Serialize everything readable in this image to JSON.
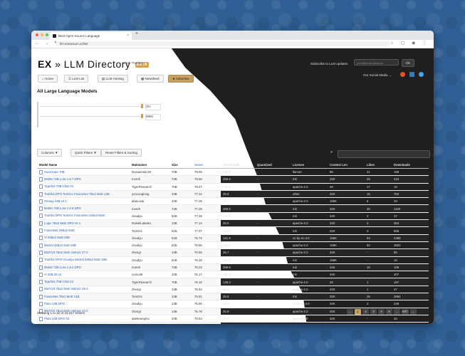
{
  "browser": {
    "tab_title": "Best Open-Source Language",
    "new_tab": "+",
    "url": "llm.extractum.io/list/",
    "nav": "← → ↻"
  },
  "header": {
    "logo_ex": "EX",
    "logo_arrow": "»",
    "logo_title": "LLM Directory",
    "logo_badge": "BETA",
    "tagline": "Dark Theme ◐",
    "subscribe_text": "Subscribe to LLM updates",
    "email_placeholder": "your@email.address",
    "ok_label": "Ok",
    "social_text": "Our Social Media →"
  },
  "nav_buttons": [
    "Home",
    "LLM List",
    "LLM Hosting",
    "Newsfeed",
    "Advertise"
  ],
  "list": {
    "title": "All Large Language Models",
    "range_min": "3%",
    "range_max": "986K",
    "columns_btn": "Columns ▼",
    "quick_filters_btn": "Quick Filters ▼",
    "reset_btn": "Reset Filters & Sorting"
  },
  "table": {
    "headers": [
      "Model Name",
      "Maintainer",
      "Size",
      "Score",
      "VRAM (GB)",
      "Quantized",
      "License",
      "Context Len",
      "Likes",
      "Downloads"
    ],
    "rows": [
      [
        "XuanYuan 70B",
        "Duxiaoman-DI",
        "70B",
        "79.05",
        "138.3",
        "-",
        "llama2",
        "8K",
        "41",
        "158"
      ],
      [
        "MoMo 72B Lora 1.8.7 DPO",
        "moreh",
        "72B",
        "78.56",
        "289.5",
        "-",
        "mit",
        "32K",
        "25",
        "416"
      ],
      [
        "Tigerbot 70B Chat V2",
        "TigerResearch",
        "70B",
        "78.07",
        "138.3",
        "-",
        "apache-2.0",
        "4K",
        "17",
        "10"
      ],
      [
        "Truthful DPO TomGrc FusionNet 7Bx2 MoE 13B",
        "yunconglong",
        "13B",
        "77.44",
        "25.9",
        "-",
        "other",
        "32K",
        "15",
        "763"
      ],
      [
        "Smaug 34B v0.1",
        "abacusai",
        "34B",
        "77.29",
        "69.2",
        "-",
        "apache-2.0",
        "195K",
        "5",
        "33"
      ],
      [
        "MoMo 72B Lora 1.8.6 DPO",
        "moreh",
        "72B",
        "77.29",
        "289.5",
        "-",
        "mit",
        "32K",
        "30",
        "1100"
      ],
      [
        "Truthful DPO TomGrc FusionNet 34Bx2 MoE",
        "cloudyu",
        "61B",
        "77.28",
        "121.9",
        "-",
        "mit",
        "32K",
        "3",
        "37"
      ],
      [
        "Logic 7Bx2 MoE DPO v0.1",
        "RubielLabarta",
        "13B",
        "77.14",
        "25.9",
        "-",
        "apache-2.0",
        "32K",
        "2",
        "363"
      ],
      [
        "FusionNet 34Bx2 MoE",
        "TomGrc",
        "61B",
        "77.07",
        "121.2",
        "-",
        "mit",
        "32K",
        "3",
        "556"
      ],
      [
        "Yi 34Bx2 MoE 60B",
        "cloudyu",
        "61B",
        "76.72",
        "121.9",
        "-",
        "cc-by-nc-4.0",
        "195K",
        "53",
        "2488"
      ],
      [
        "Mixtral 34Bx2 MoE 60B",
        "cloudyu",
        "61B",
        "76.66",
        "121.9",
        "-",
        "apache-2.0",
        "195K",
        "92",
        "3602"
      ],
      [
        "MixTAO 7Bx2 MoE Instruct V7.0",
        "zhengr",
        "13B",
        "76.55",
        "25.7",
        "-",
        "apache-2.0",
        "32K",
        "-",
        "85"
      ],
      [
        "Truthful DPO Cloudyu Mixtral 34Bx2 MoE 60B",
        "cloudyu",
        "61B",
        "76.48",
        "121.9",
        "-",
        "mit",
        "195K",
        "-",
        "10"
      ],
      [
        "MoMo 72B Lora 1.8.4 DPO",
        "moreh",
        "72B",
        "76.23",
        "289.5",
        "-",
        "mit",
        "32K",
        "10",
        "108"
      ],
      [
        "Yi 34B 20 v2",
        "cumo45",
        "34B",
        "76.17",
        "121.9",
        "-",
        "mit",
        "32K",
        "-",
        "407"
      ],
      [
        "Tigerbot 70B Chat V4",
        "TigerResearch",
        "70B",
        "76.16",
        "138.3",
        "-",
        "apache-2.0",
        "4K",
        "1",
        "187"
      ],
      [
        "MixTAO 7Bx2 MoE Instruct V8.0",
        "zhengr",
        "13B",
        "75.94",
        "25.9",
        "-",
        "apache-2.0",
        "32K",
        "1",
        "27"
      ],
      [
        "FusionNet 7Bx2 MoE 14B",
        "TomGrc",
        "13B",
        "75.91",
        "25.9",
        "-",
        "mit",
        "32K",
        "26",
        "2864"
      ],
      [
        "Pluto 13B DPO",
        "cloudyu",
        "13B",
        "75.86",
        "25.9",
        "-",
        "cc-by-nc-4.0",
        "32K",
        "3",
        "238"
      ],
      [
        "MixTAO 7Bx2 MoE Instruct V4.0",
        "zhengr",
        "13B",
        "75.78",
        "25.9",
        "-",
        "apache-2.0",
        "32K",
        "3",
        "308"
      ],
      [
        "Pluto 24B DPO 63",
        "daekeungmu",
        "24B",
        "75.63",
        "25.9",
        "-",
        "apache-2.0",
        "32K",
        "-",
        "34"
      ],
      [
        "Supermario V2",
        "vanillaOVO",
        "7B",
        "75.60",
        "14.4",
        "-",
        "apache-2.0",
        "32K",
        "-",
        "81"
      ]
    ]
  },
  "footer": {
    "showing": "Showing 1 to 22 of 15,317 entries",
    "pages": [
      "←",
      "1",
      "2",
      "3",
      "4",
      "5",
      "...",
      "697",
      "→"
    ]
  },
  "colors": {
    "accent_gold": "#c9a063",
    "link_blue": "#2a5fb0",
    "dark_bg": "#1f1f1f"
  }
}
